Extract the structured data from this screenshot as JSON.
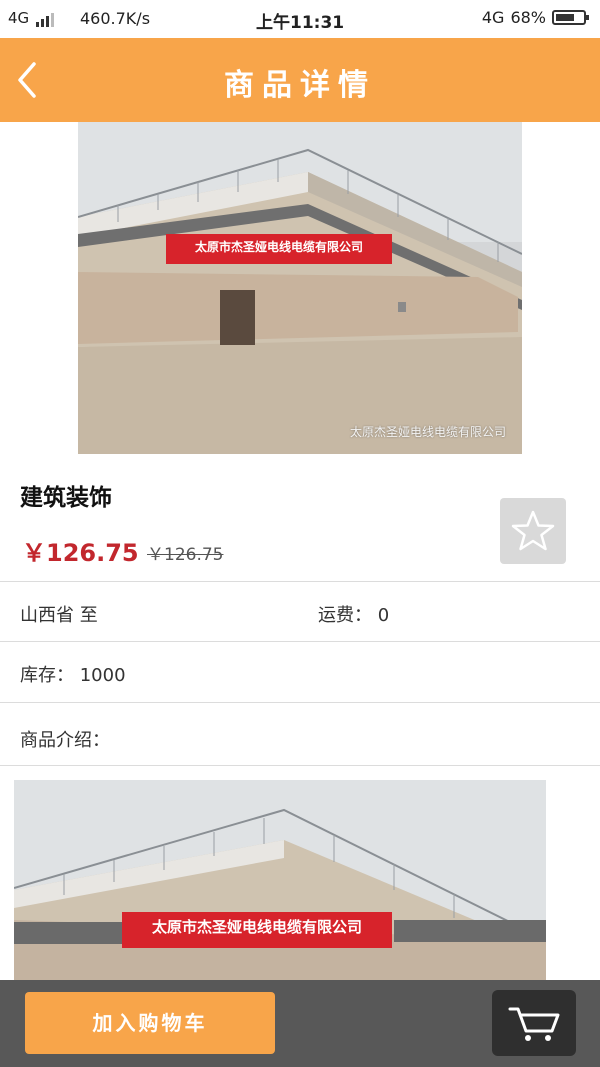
{
  "status_bar": {
    "network": "4G",
    "speed": "460.7K/s",
    "time": "上午11:31",
    "network_right": "4G",
    "battery": "68%",
    "battery_level": 0.68
  },
  "header": {
    "title": "商品详情",
    "back_icon": "chevron-left-icon"
  },
  "product": {
    "image_banner_text": "太原市杰圣娅电线电缆有限公司",
    "image_watermark": "太原杰圣娅电线电缆有限公司",
    "name": "建筑装饰",
    "price": "￥126.75",
    "original_price": "￥126.75",
    "favorite_icon": "star-icon"
  },
  "info": {
    "origin": "山西省 至",
    "shipping": "运费： 0",
    "stock": "库存： 1000",
    "intro_label": "商品介绍："
  },
  "bottom_bar": {
    "add_to_cart_label": "加入购物车",
    "cart_icon": "cart-icon"
  },
  "colors": {
    "accent": "#f8a54a",
    "price": "#c2272d",
    "bottom_bar": "#585858",
    "cart_button": "#2f2f2f"
  }
}
